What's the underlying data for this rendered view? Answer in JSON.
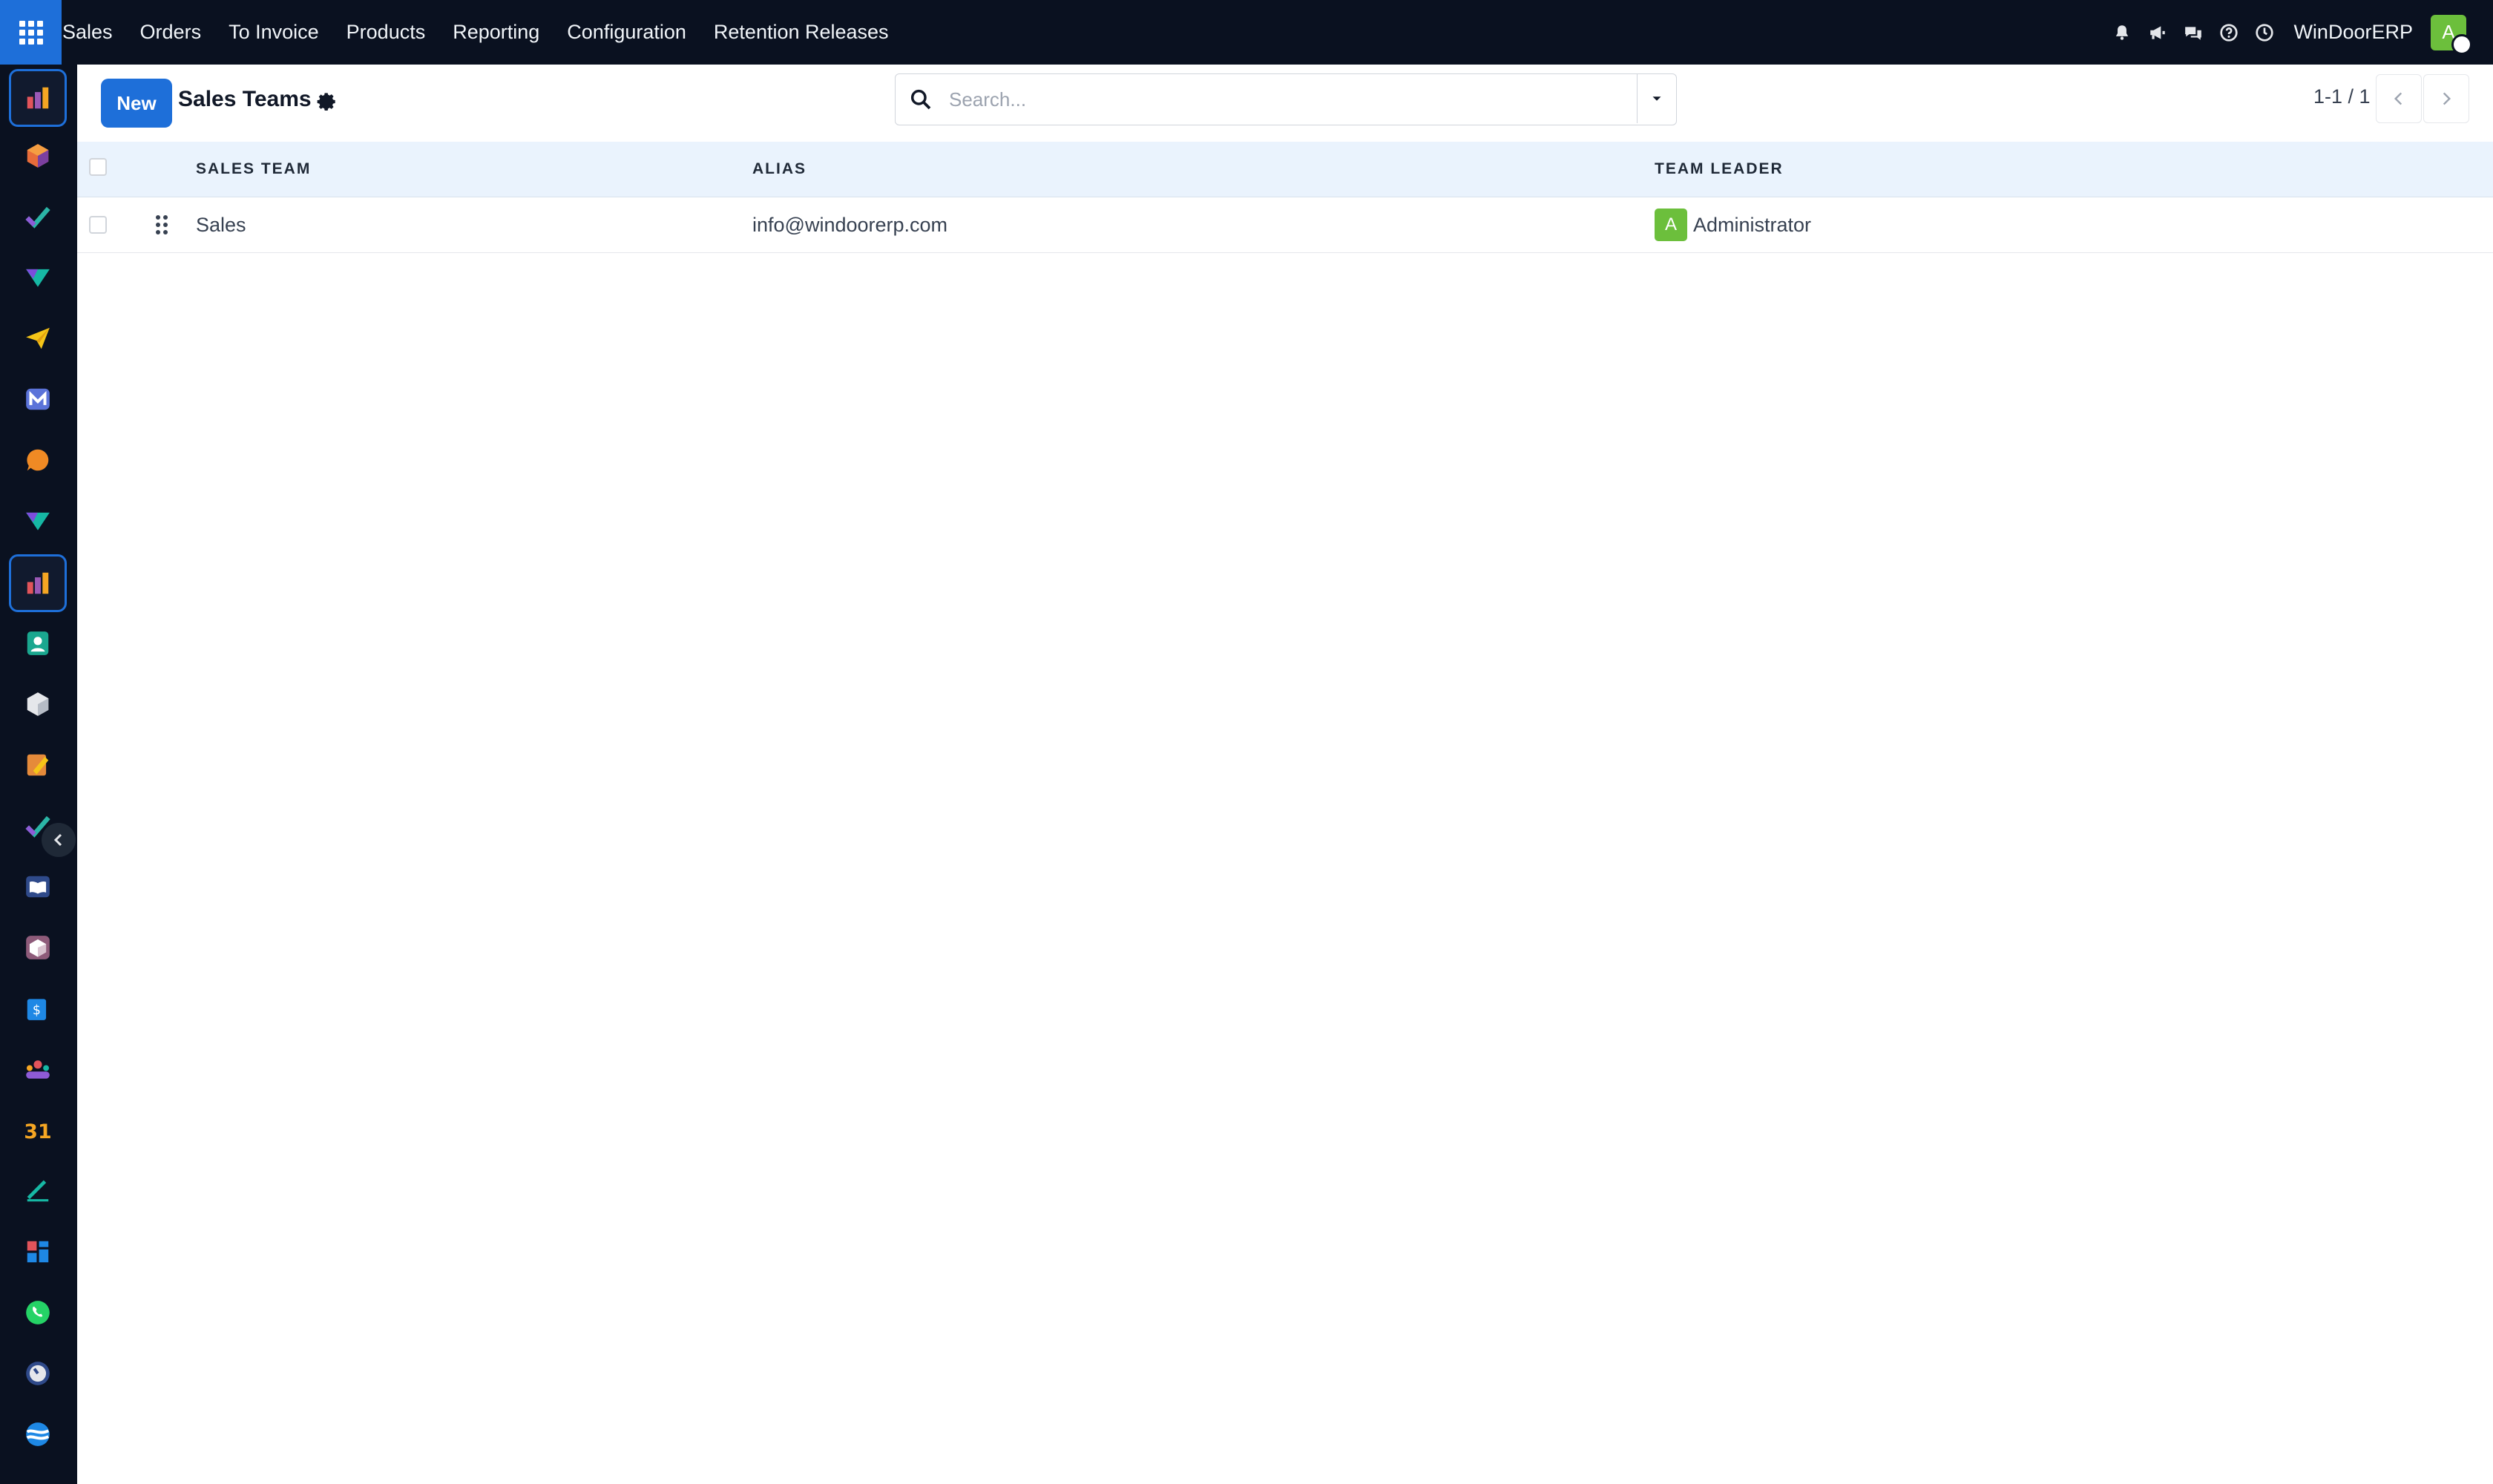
{
  "navbar": {
    "menu_items": [
      "Sales",
      "Orders",
      "To Invoice",
      "Products",
      "Reporting",
      "Configuration",
      "Retention Releases"
    ],
    "company": "WinDoorERP",
    "user_initial": "A",
    "icons": [
      "apps-grid-icon",
      "bell-icon",
      "megaphone-icon",
      "chat-icon",
      "help-icon",
      "clock-icon"
    ]
  },
  "control_panel": {
    "new_label": "New",
    "title": "Sales Teams",
    "search_placeholder": "Search...",
    "pager": "1-1 / 1"
  },
  "list": {
    "columns": [
      "SALES TEAM",
      "ALIAS",
      "TEAM LEADER"
    ],
    "rows": [
      {
        "team": "Sales",
        "alias": "info@windoorerp.com",
        "leader": "Administrator",
        "leader_initial": "A"
      }
    ]
  },
  "sidebar_apps": [
    "sales-icon",
    "inventory-icon",
    "project-icon",
    "discuss-icon",
    "email-marketing-icon",
    "mail-icon",
    "live-chat-icon",
    "survey-icon",
    "sales-icon",
    "contacts-icon",
    "products-icon",
    "studio-icon",
    "todo-icon",
    "knowledge-icon",
    "packages-icon",
    "invoicing-icon",
    "employees-icon",
    "calendar-icon",
    "sign-icon",
    "dashboards-icon",
    "whatsapp-icon",
    "timer-icon",
    "settings-icon"
  ],
  "colors": {
    "navbar_bg": "#0a1120",
    "accent": "#1e6fd9",
    "header_row_bg": "#eaf3fd",
    "avatar_green": "#6cbf3c"
  }
}
